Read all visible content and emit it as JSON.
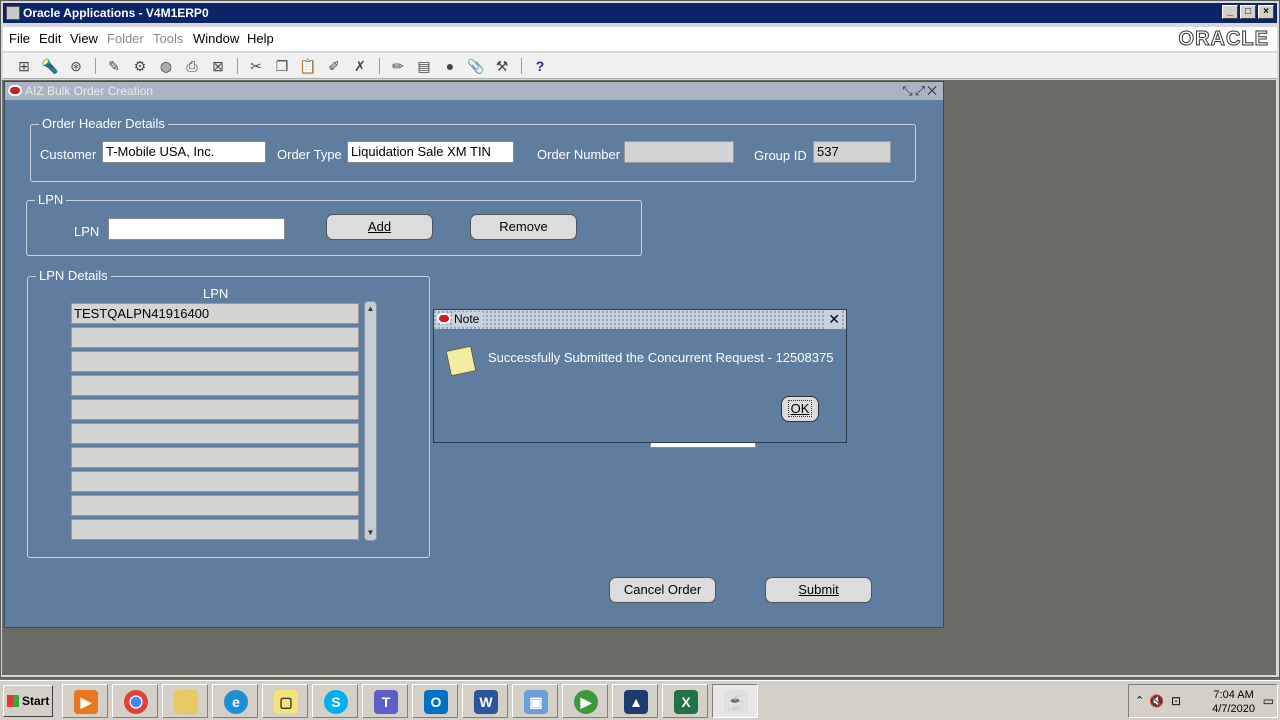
{
  "window": {
    "title": "Oracle Applications - V4M1ERP0",
    "logo": "ORACLE"
  },
  "menu": [
    "File",
    "Edit",
    "View",
    "Folder",
    "Tools",
    "Window",
    "Help"
  ],
  "form": {
    "title": "AIZ Bulk Order Creation",
    "header_group": "Order Header Details",
    "customer_label": "Customer",
    "customer_value": "T-Mobile USA, Inc.",
    "order_type_label": "Order Type",
    "order_type_value": "Liquidation Sale XM TIN",
    "order_number_label": "Order Number",
    "order_number_value": "",
    "group_id_label": "Group ID",
    "group_id_value": "537",
    "lpn_group": "LPN",
    "lpn_label": "LPN",
    "lpn_value": "",
    "add_label": "Add",
    "remove_label": "Remove",
    "details_group": "LPN Details",
    "details_col_header": "LPN",
    "lpn_rows": [
      "TESTQALPN41916400",
      "",
      "",
      "",
      "",
      "",
      "",
      "",
      "",
      ""
    ],
    "cancel_label": "Cancel Order",
    "submit_label": "Submit"
  },
  "note": {
    "title": "Note",
    "message": "Successfully Submitted the Concurrent Request - 12508375",
    "ok_label": "OK"
  },
  "taskbar": {
    "start_label": "Start",
    "time": "7:04 AM",
    "date": "4/7/2020"
  }
}
